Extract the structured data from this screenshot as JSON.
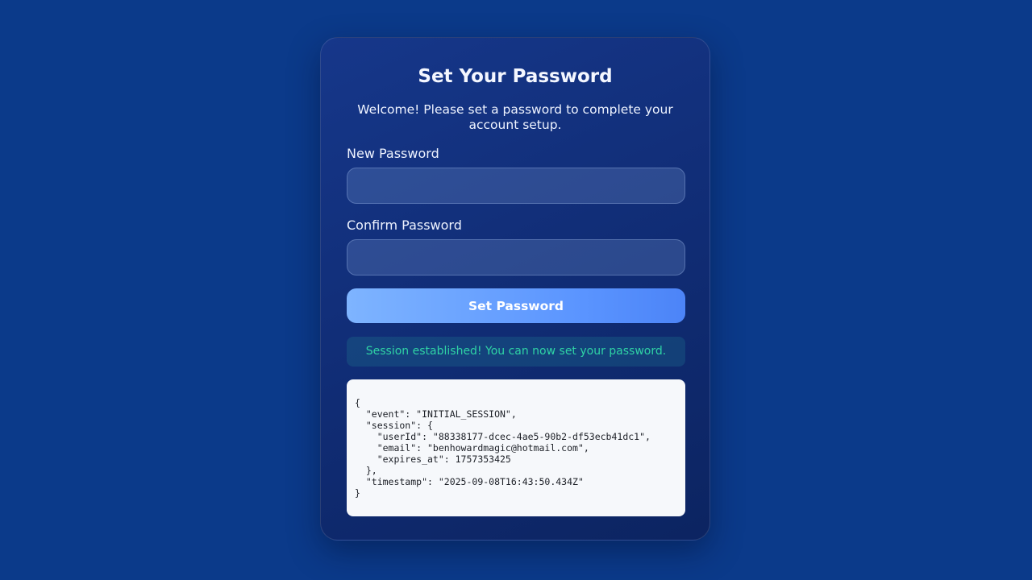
{
  "form": {
    "title": "Set Your Password",
    "subtitle": "Welcome! Please set a password to complete your account setup.",
    "new_password_label": "New Password",
    "new_password_value": "",
    "confirm_password_label": "Confirm Password",
    "confirm_password_value": "",
    "submit_label": "Set Password"
  },
  "status": {
    "message": "Session established! You can now set your password."
  },
  "debug": {
    "json_text": "{\n  \"event\": \"INITIAL_SESSION\",\n  \"session\": {\n    \"userId\": \"88338177-dcec-4ae5-90b2-df53ecb41dc1\",\n    \"email\": \"benhowardmagic@hotmail.com\",\n    \"expires_at\": 1757353425\n  },\n  \"timestamp\": \"2025-09-08T16:43:50.434Z\"\n}"
  },
  "colors": {
    "page_background": "#0b3a8a",
    "card_background": "#102c74",
    "button_accent": "#5a94ff",
    "success_text": "#2fd3a5"
  }
}
